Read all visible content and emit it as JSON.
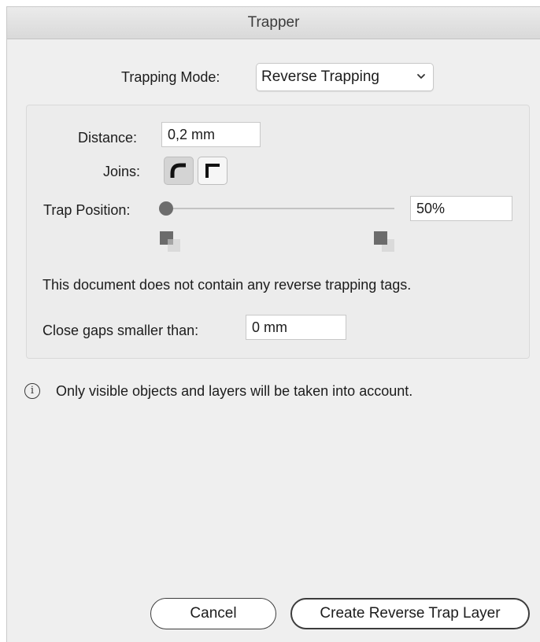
{
  "window": {
    "title": "Trapper"
  },
  "trapping_mode": {
    "label": "Trapping Mode:",
    "value": "Reverse Trapping",
    "icon": "chevron-down-icon"
  },
  "distance": {
    "label": "Distance:",
    "value": "0,2 mm"
  },
  "joins": {
    "label": "Joins:",
    "options": [
      "round-join-icon",
      "miter-join-icon"
    ],
    "selected": "round"
  },
  "trap_position": {
    "label": "Trap Position:",
    "value": "50%",
    "slider_fraction": 0.0
  },
  "message": "This document does not contain any reverse trapping tags.",
  "close_gaps": {
    "label": "Close gaps smaller than:",
    "value": "0 mm"
  },
  "info": {
    "icon": "info-icon",
    "glyph": "i",
    "text": "Only visible objects and layers will be taken into account."
  },
  "buttons": {
    "cancel": "Cancel",
    "create": "Create Reverse Trap Layer"
  },
  "colors": {
    "dialog_bg": "#efefef",
    "field_bg": "#ffffff",
    "button_border": "#3c3c3c"
  }
}
